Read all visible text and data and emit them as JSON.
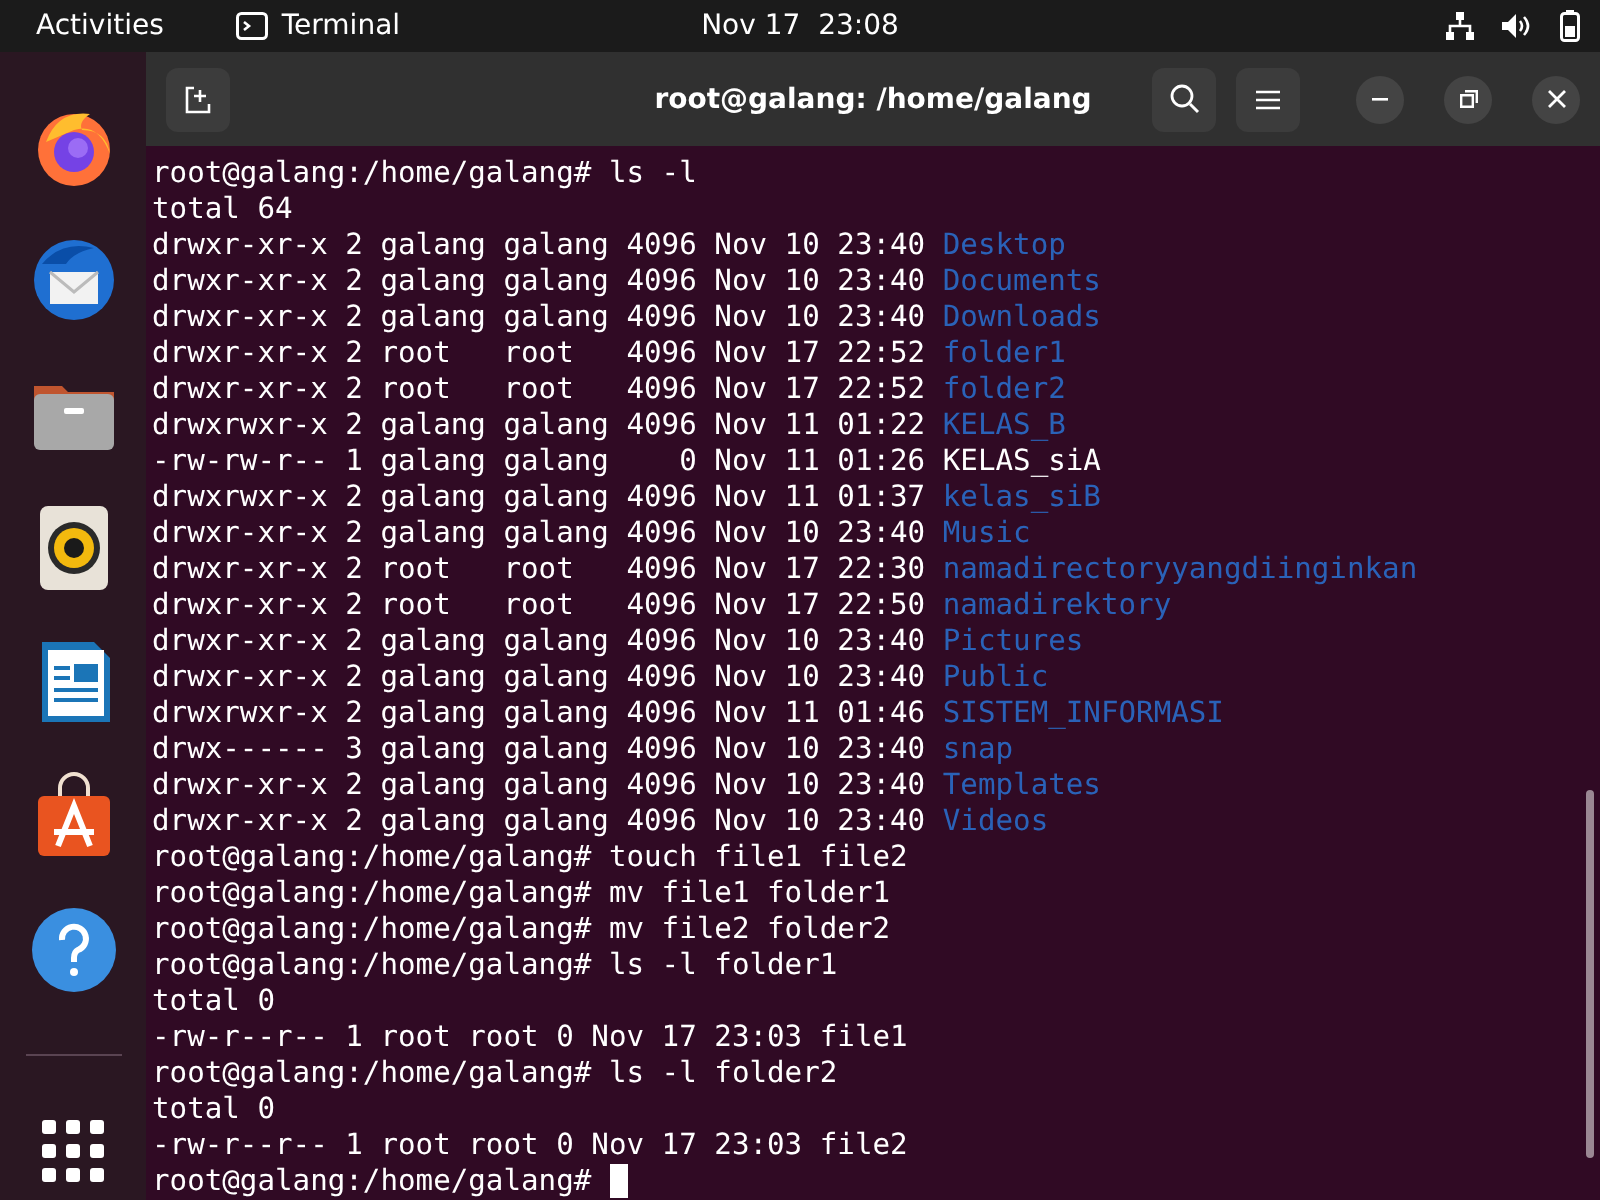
{
  "top_bar": {
    "activities": "Activities",
    "app_name": "Terminal",
    "clock": "Nov 17  23:08"
  },
  "dock": {
    "apps": [
      {
        "kind": "firefox"
      },
      {
        "kind": "thunderbird"
      },
      {
        "kind": "files"
      },
      {
        "kind": "rhythmbox"
      },
      {
        "kind": "writer"
      },
      {
        "kind": "software"
      },
      {
        "kind": "help"
      }
    ]
  },
  "window": {
    "title": "root@galang: /home/galang",
    "lines": [
      {
        "kind": "prompt",
        "text": "root@galang:/home/galang# ls -l"
      },
      {
        "kind": "output",
        "text": "total 64"
      },
      {
        "kind": "entry",
        "meta": "drwxr-xr-x 2 galang galang 4096 Nov 10 23:40",
        "name": "Desktop",
        "color": "#2a62b8"
      },
      {
        "kind": "entry",
        "meta": "drwxr-xr-x 2 galang galang 4096 Nov 10 23:40",
        "name": "Documents",
        "color": "#2a62b8"
      },
      {
        "kind": "entry",
        "meta": "drwxr-xr-x 2 galang galang 4096 Nov 10 23:40",
        "name": "Downloads",
        "color": "#2a62b8"
      },
      {
        "kind": "entry",
        "meta": "drwxr-xr-x 2 root   root   4096 Nov 17 22:52",
        "name": "folder1",
        "color": "#2a62b8"
      },
      {
        "kind": "entry",
        "meta": "drwxr-xr-x 2 root   root   4096 Nov 17 22:52",
        "name": "folder2",
        "color": "#2a62b8"
      },
      {
        "kind": "entry",
        "meta": "drwxrwxr-x 2 galang galang 4096 Nov 11 01:22",
        "name": "KELAS_B",
        "color": "#2a62b8"
      },
      {
        "kind": "entry",
        "meta": "-rw-rw-r-- 1 galang galang    0 Nov 11 01:26",
        "name": "KELAS_siA",
        "color": "#ffffff"
      },
      {
        "kind": "entry",
        "meta": "drwxrwxr-x 2 galang galang 4096 Nov 11 01:37",
        "name": "kelas_siB",
        "color": "#2a62b8"
      },
      {
        "kind": "entry",
        "meta": "drwxr-xr-x 2 galang galang 4096 Nov 10 23:40",
        "name": "Music",
        "color": "#2a62b8"
      },
      {
        "kind": "entry",
        "meta": "drwxr-xr-x 2 root   root   4096 Nov 17 22:30",
        "name": "namadirectoryyangdiinginkan",
        "color": "#2a62b8"
      },
      {
        "kind": "entry",
        "meta": "drwxr-xr-x 2 root   root   4096 Nov 17 22:50",
        "name": "namadirektory",
        "color": "#2a62b8"
      },
      {
        "kind": "entry",
        "meta": "drwxr-xr-x 2 galang galang 4096 Nov 10 23:40",
        "name": "Pictures",
        "color": "#2a62b8"
      },
      {
        "kind": "entry",
        "meta": "drwxr-xr-x 2 galang galang 4096 Nov 10 23:40",
        "name": "Public",
        "color": "#2a62b8"
      },
      {
        "kind": "entry",
        "meta": "drwxrwxr-x 2 galang galang 4096 Nov 11 01:46",
        "name": "SISTEM_INFORMASI",
        "color": "#2a62b8"
      },
      {
        "kind": "entry",
        "meta": "drwx------ 3 galang galang 4096 Nov 10 23:40",
        "name": "snap",
        "color": "#2a62b8"
      },
      {
        "kind": "entry",
        "meta": "drwxr-xr-x 2 galang galang 4096 Nov 10 23:40",
        "name": "Templates",
        "color": "#2a62b8"
      },
      {
        "kind": "entry",
        "meta": "drwxr-xr-x 2 galang galang 4096 Nov 10 23:40",
        "name": "Videos",
        "color": "#2a62b8"
      },
      {
        "kind": "prompt",
        "text": "root@galang:/home/galang# touch file1 file2"
      },
      {
        "kind": "prompt",
        "text": "root@galang:/home/galang# mv file1 folder1"
      },
      {
        "kind": "prompt",
        "text": "root@galang:/home/galang# mv file2 folder2"
      },
      {
        "kind": "prompt",
        "text": "root@galang:/home/galang# ls -l folder1"
      },
      {
        "kind": "output",
        "text": "total 0"
      },
      {
        "kind": "output",
        "text": "-rw-r--r-- 1 root root 0 Nov 17 23:03 file1"
      },
      {
        "kind": "prompt",
        "text": "root@galang:/home/galang# ls -l folder2"
      },
      {
        "kind": "output",
        "text": "total 0"
      },
      {
        "kind": "output",
        "text": "-rw-r--r-- 1 root root 0 Nov 17 23:03 file2"
      },
      {
        "kind": "cursor",
        "text": "root@galang:/home/galang#"
      }
    ]
  }
}
